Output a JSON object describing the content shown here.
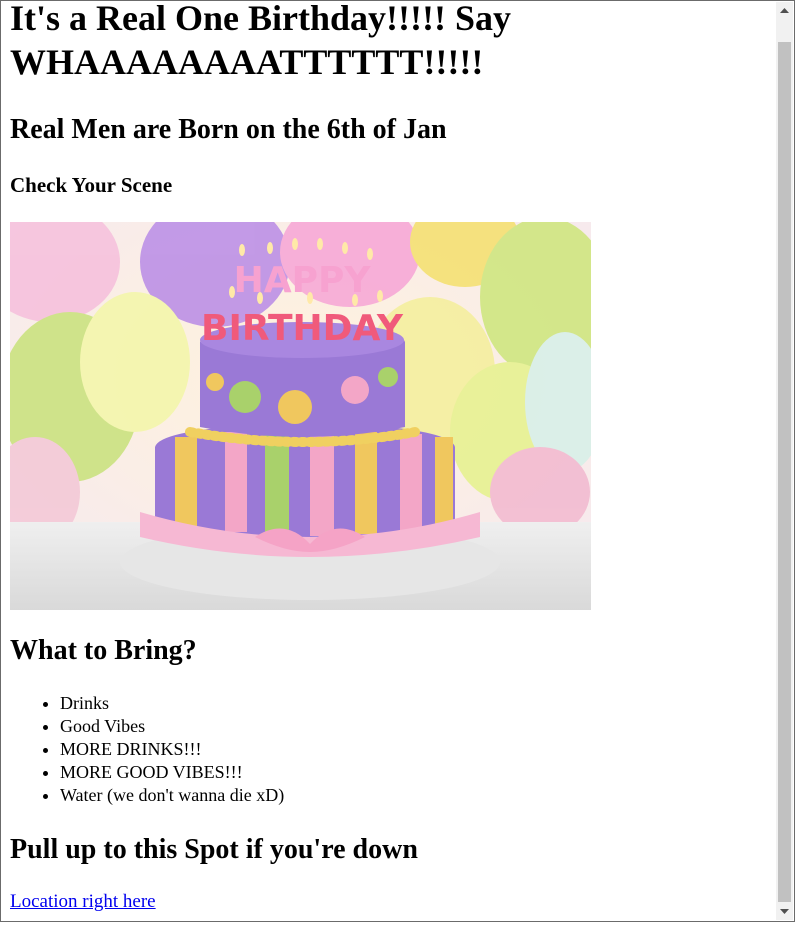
{
  "heading_main": "It's a Real One Birthday!!!!! Say WHAAAAAAAATTTTTT!!!!!",
  "heading_date": "Real Men are Born on the 6th of Jan",
  "heading_scene": "Check Your Scene",
  "cake_image": {
    "text_top": "HAPPY",
    "text_bottom": "BIRTHDAY"
  },
  "heading_bring": "What to Bring?",
  "bring_items": [
    "Drinks",
    "Good Vibes",
    "MORE DRINKS!!!",
    "MORE GOOD VIBES!!!",
    "Water (we don't wanna die xD)"
  ],
  "heading_spot": "Pull up to this Spot if you're down",
  "location_link": "Location right here",
  "colors": {
    "link": "#0000ee",
    "scroll_thumb": "#c1c1c1",
    "scroll_track": "#f1f1f1"
  }
}
